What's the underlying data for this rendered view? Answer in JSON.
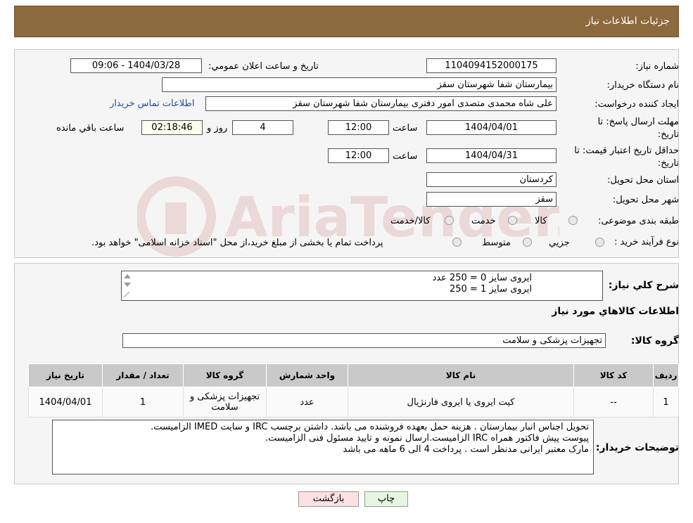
{
  "header": {
    "title": "جزئیات اطلاعات نیاز"
  },
  "watermark": {
    "brand": "AriaTender.neT"
  },
  "need": {
    "number_label": "شماره نیاز:",
    "number_value": "1104094152000175",
    "announce_label": "تاریخ و ساعت اعلان عمومي:",
    "announce_value": "1404/03/28 - 09:06",
    "buyer_label": "نام دستگاه خريدار:",
    "buyer_value": "بيمارستان شفا شهرستان سقز",
    "creator_label": "ايجاد کننده درخواست:",
    "creator_value": "علی شاه محمدی متصدی امور دفتری بیمارستان شفا شهرستان سقز",
    "contact_link": "اطلاعات تماس خريدار",
    "deadline_label": "مهلت ارسال پاسخ: تا",
    "deadline_label2": "تاريخ:",
    "deadline_date": "1404/04/01",
    "time_label": "ساعت",
    "deadline_time": "12:00",
    "days_value": "4",
    "days_label": "روز و",
    "remaining_value": "02:18:46",
    "remaining_label": "ساعت باقي مانده",
    "price_valid_label": "حداقل تاريخ اعتبار قيمت: تا",
    "price_valid_label2": "تاريخ:",
    "price_valid_date": "1404/04/31",
    "price_valid_time": "12:00",
    "province_label": "استان محل تحويل:",
    "province_value": "کردستان",
    "city_label": "شهر محل تحويل:",
    "city_value": "سقز",
    "category_label": "طبقه بندی موضوعی:",
    "category_options": [
      "کالا",
      "خدمت",
      "کالا/خدمت"
    ],
    "process_label": "نوع فرآيند خريد :",
    "process_options": [
      "جزيي",
      "متوسط"
    ],
    "process_note": "پرداخت تمام يا بخشی از مبلغ خريد،از محل \"اسناد خزانه اسلامی\" خواهد بود."
  },
  "details": {
    "summary_label": "شرح کلي نياز:",
    "summary_lines": [
      "ایروی سایز 0 = 250 عدد",
      "ایروی سایز 1 = 250"
    ],
    "goods_info_title": "اطلاعات کالاهاي مورد نياز",
    "goods_group_label": "گروه کالا:",
    "goods_group_value": "تجهيزات پزشکی و سلامت",
    "table": {
      "headers": [
        "رديف",
        "کد کالا",
        "نام کالا",
        "واحد شمارش",
        "گروه کالا",
        "تعداد / مقدار",
        "تاريخ نياز"
      ],
      "rows": [
        [
          "1",
          "--",
          "کیت ایروی یا ایروی فارنژیال",
          "عدد",
          "تجهيزات پزشکی و سلامت",
          "1",
          "1404/04/01"
        ]
      ]
    },
    "buyer_notes_label": "توضيحات خريدار:",
    "buyer_notes_lines": [
      "تحویل اجناس  انبار بیمارستان . هزینه حمل بعهده فروشنده می باشد.  داشتن برچسب IRC  و سایت  IMED  الزامیست.",
      "پیوست پیش فاکتور همراه IRC  الزامیست.ارسال نمونه و تایید مسئول فنی الزامیست.",
      "مارک معتبر ایرانی مدنظر است . پرداخت 4 الی 6 ماهه می باشد"
    ]
  },
  "buttons": {
    "print": "چاپ",
    "back": "بازگشت"
  },
  "colors": {
    "header_bg": "#8b6a3e",
    "link": "#1a4fb0",
    "back_bg": "#fde0e0",
    "print_bg": "#e6f7e0"
  }
}
